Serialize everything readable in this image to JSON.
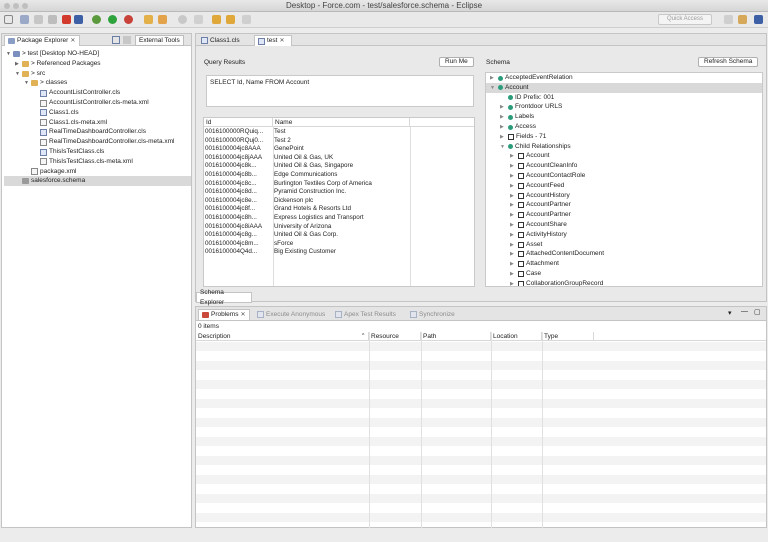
{
  "window": {
    "title": "Desktop - Force.com - test/salesforce.schema - Eclipse"
  },
  "toolbar": {
    "quick_access": "Quick Access",
    "tooltip": "External Tools"
  },
  "package_explorer": {
    "tab": "Package Explorer",
    "items": [
      {
        "label": "> test [Desktop NO-HEAD]",
        "kind": "project",
        "indent": 0,
        "arrow": "▼"
      },
      {
        "label": "> Referenced Packages",
        "kind": "folder",
        "indent": 1,
        "arrow": "▶"
      },
      {
        "label": "> src",
        "kind": "folder",
        "indent": 1,
        "arrow": "▼"
      },
      {
        "label": "> classes",
        "kind": "folder",
        "indent": 2,
        "arrow": "▼"
      },
      {
        "label": "AccountListController.cls",
        "kind": "class",
        "indent": 3
      },
      {
        "label": "AccountListController.cls-meta.xml",
        "kind": "xml",
        "indent": 3
      },
      {
        "label": "Class1.cls",
        "kind": "class",
        "indent": 3
      },
      {
        "label": "Class1.cls-meta.xml",
        "kind": "xml",
        "indent": 3
      },
      {
        "label": "RealTimeDashboardController.cls",
        "kind": "class",
        "indent": 3
      },
      {
        "label": "RealTimeDashboardController.cls-meta.xml",
        "kind": "xml",
        "indent": 3
      },
      {
        "label": "ThisIsTestClass.cls",
        "kind": "class",
        "indent": 3
      },
      {
        "label": "ThisIsTestClass.cls-meta.xml",
        "kind": "xml",
        "indent": 3
      },
      {
        "label": "package.xml",
        "kind": "xml",
        "indent": 2
      },
      {
        "label": "salesforce.schema",
        "kind": "schema",
        "indent": 1,
        "selected": true
      }
    ]
  },
  "editor": {
    "tabs": [
      "Class1.cls",
      "test"
    ],
    "query_results_label": "Query Results",
    "run_me": "Run Me",
    "query": "SELECT Id, Name FROM Account",
    "columns": [
      "Id",
      "Name"
    ],
    "rows": [
      [
        "0016100000RQuiq...",
        "Test"
      ],
      [
        "0016100000RQuj0...",
        "Test 2"
      ],
      [
        "0016100004jc8AAA",
        "GenePoint"
      ],
      [
        "0016100004jc8jAAA",
        "United Oil & Gas, UK"
      ],
      [
        "0016100004jc8k...",
        "United Oil & Gas, Singapore"
      ],
      [
        "0016100004jc8b...",
        "Edge Communications"
      ],
      [
        "0016100004jc8c...",
        "Burlington Textiles Corp of America"
      ],
      [
        "0016100004jc8d...",
        "Pyramid Construction Inc."
      ],
      [
        "0016100004jc8e...",
        "Dickenson plc"
      ],
      [
        "0016100004jc8f...",
        "Grand Hotels & Resorts Ltd"
      ],
      [
        "0016100004jc8h...",
        "Express Logistics and Transport"
      ],
      [
        "0016100004jc8iAAA",
        "University of Arizona"
      ],
      [
        "0016100004jc8g...",
        "United Oil & Gas Corp."
      ],
      [
        "0016100004jc8m...",
        "sForce"
      ],
      [
        "0016100004Q4d...",
        "Big Existing Customer"
      ]
    ],
    "schema_label": "Schema",
    "refresh_schema": "Refresh Schema",
    "schema": [
      {
        "label": "AcceptedEventRelation",
        "indent": 0,
        "icon": "dot",
        "arrow": "▶"
      },
      {
        "label": "Account",
        "indent": 0,
        "icon": "dot",
        "arrow": "▼",
        "selected": true
      },
      {
        "label": "ID Prefix: 001",
        "indent": 1,
        "icon": "dot",
        "arrow": ""
      },
      {
        "label": "Frontdoor URLS",
        "indent": 1,
        "icon": "dot",
        "arrow": "▶"
      },
      {
        "label": "Labels",
        "indent": 1,
        "icon": "dot",
        "arrow": "▶"
      },
      {
        "label": "Access",
        "indent": 1,
        "icon": "dot",
        "arrow": "▶"
      },
      {
        "label": "Fields - 71",
        "indent": 1,
        "icon": "chk",
        "arrow": "▶"
      },
      {
        "label": "Child Relationships",
        "indent": 1,
        "icon": "dot",
        "arrow": "▼"
      },
      {
        "label": "Account",
        "indent": 2,
        "icon": "chk",
        "arrow": "▶"
      },
      {
        "label": "AccountCleanInfo",
        "indent": 2,
        "icon": "chk",
        "arrow": "▶"
      },
      {
        "label": "AccountContactRole",
        "indent": 2,
        "icon": "chk",
        "arrow": "▶"
      },
      {
        "label": "AccountFeed",
        "indent": 2,
        "icon": "chk",
        "arrow": "▶"
      },
      {
        "label": "AccountHistory",
        "indent": 2,
        "icon": "chk",
        "arrow": "▶"
      },
      {
        "label": "AccountPartner",
        "indent": 2,
        "icon": "chk",
        "arrow": "▶"
      },
      {
        "label": "AccountPartner",
        "indent": 2,
        "icon": "chk",
        "arrow": "▶"
      },
      {
        "label": "AccountShare",
        "indent": 2,
        "icon": "chk",
        "arrow": "▶"
      },
      {
        "label": "ActivityHistory",
        "indent": 2,
        "icon": "chk",
        "arrow": "▶"
      },
      {
        "label": "Asset",
        "indent": 2,
        "icon": "chk",
        "arrow": "▶"
      },
      {
        "label": "AttachedContentDocument",
        "indent": 2,
        "icon": "chk",
        "arrow": "▶"
      },
      {
        "label": "Attachment",
        "indent": 2,
        "icon": "chk",
        "arrow": "▶"
      },
      {
        "label": "Case",
        "indent": 2,
        "icon": "chk",
        "arrow": "▶"
      },
      {
        "label": "CollaborationGroupRecord",
        "indent": 2,
        "icon": "chk",
        "arrow": "▶"
      }
    ],
    "bottom_tab": "Schema Explorer"
  },
  "problems": {
    "tabs": [
      "Problems",
      "Execute Anonymous",
      "Apex Test Results",
      "Synchronize"
    ],
    "count": "0 items",
    "columns": [
      "Description",
      "Resource",
      "Path",
      "Location",
      "Type"
    ]
  }
}
